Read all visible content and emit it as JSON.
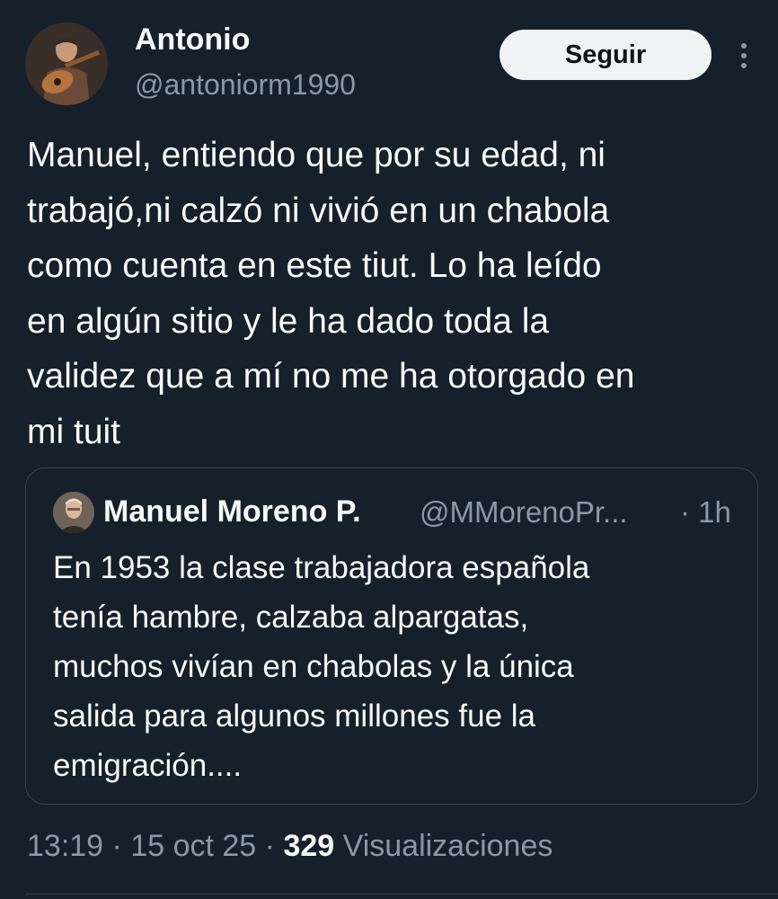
{
  "author": {
    "display_name": "Antonio",
    "handle": "@antoniorm1990",
    "avatar_icon": "guitarist-avatar"
  },
  "actions": {
    "follow_label": "Seguir",
    "more_icon": "more-vertical-icon"
  },
  "tweet": {
    "text": "Manuel, entiendo que por su edad, ni\ntrabajó,ni calzó ni vivió en un chabola\ncomo cuenta en este tiut. Lo ha leído\nen algún sitio y le ha dado toda la\nvalidez que a mí no me ha otorgado en\nmi tuit"
  },
  "quote": {
    "display_name": "Manuel Moreno P.",
    "handle": "@MMorenoPr...",
    "time": "· 1h",
    "text": "En 1953 la clase trabajadora española\ntenía hambre, calzaba alpargatas,\nmuchos vivían en chabolas y la única\nsalida para algunos millones fue la\nemigración....",
    "avatar_icon": "man-portrait-avatar"
  },
  "meta": {
    "time": "13:19",
    "sep1": "·",
    "date": "15 oct 25",
    "sep2": "·",
    "views_count": "329",
    "views_label": "Visualizaciones"
  },
  "colors": {
    "background": "#15202b",
    "text_primary": "#f7f9f9",
    "text_secondary": "#8b98a5",
    "border": "#38444d",
    "button_bg": "#eff3f4"
  }
}
